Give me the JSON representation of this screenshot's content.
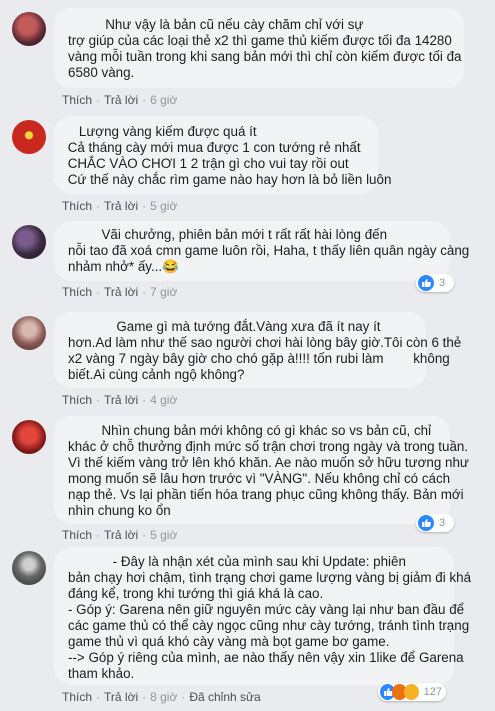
{
  "comments": [
    {
      "lines": [
        "          Như vậy là bản cũ nếu cày chăm chỉ với sự",
        "trợ giúp của các loại thẻ x2 thì game thủ kiếm được tối đa 14280",
        "vàng mỗi tuần trong khi sang bản mới thì chỉ còn kiếm được tối đa",
        "6580 vàng."
      ],
      "actions": [
        "Thích",
        "Trả lời"
      ],
      "time": "6 giờ"
    },
    {
      "lines": [
        "    Lượng vàng kiếm được quá ít",
        " Cả tháng cày mới mua được 1 con tướng rẻ nhất",
        " CHẮC VÀO CHƠI 1 2 trận gì cho vui tay rồi out",
        " Cứ thế này chắc rìm game nào hay hơn là bỏ liền luôn"
      ],
      "actions": [
        "Thích",
        "Trả lời"
      ],
      "time": "5 giờ"
    },
    {
      "lines": [
        "         Vãi chưởng, phiên bản mới t rất rất hài lòng đến",
        "nỗi tao đã xoá cmn game luôn rồi, Haha, t thấy liên quân ngày càng",
        "nhảm nhở* ấy...😂"
      ],
      "actions": [
        "Thích",
        "Trả lời"
      ],
      "time": "7 giờ",
      "reactions": {
        "count": "3"
      }
    },
    {
      "lines": [
        "             Game gì mà tướng đắt.Vàng xưa đã ít nay ít",
        "hơn.Ad làm như thế sao người chơi hài lòng bây giờ.Tôi còn 6 thẻ",
        "x2 vàng 7 ngày bây giờ cho chó gặp à!!!! tốn rubi làm        không",
        "biết.Ai cùng cảnh ngộ không?"
      ],
      "actions": [
        "Thích",
        "Trả lời"
      ],
      "time": "4 giờ"
    },
    {
      "lines": [
        "         Nhìn chung bản mới không có gì khác so vs bản cũ, chỉ",
        "khác ở chỗ thưởng định mức số trận chơi trong ngày và trong tuần.",
        "Vì thế kiếm vàng trở lên khó khăn. Ae nào muốn sở hữu tương như",
        "mong muốn sẽ lâu hơn trước vì \"VÀNG\". Nếu không chỉ có cách",
        "nạp thẻ. Vs lại phần tiến hóa trang phục cũng không thấy. Bản mới",
        "nhìn chung ko ổn"
      ],
      "actions": [
        "Thích",
        "Trả lời"
      ],
      "time": "5 giờ",
      "reactions": {
        "count": "3"
      }
    },
    {
      "lines": [
        "            - Đây là nhận xét của mình sau khi Update: phiên",
        "bản chạy hơi chậm, tình trạng chơi game lượng vàng bị giảm đi khá",
        "đáng kể, trong khi tướng thì giá khá là cao.",
        "- Góp ý: Garena nên giữ nguyên mức cày vàng lại như ban đầu để",
        "các game thủ có thể cày ngọc cũng như cày tướng, tránh tình trạng",
        "game thủ vì quá khó cày vàng mà bọt game bơ game.",
        "--> Góp ý riêng của mình, ae nào thấy nên vậy xin 1like để Garena",
        "tham khảo."
      ],
      "actions": [
        "Thích",
        "Trả lời"
      ],
      "time": "8 giờ",
      "edited": "Đã chỉnh sửa",
      "reactions": {
        "count": "127"
      }
    }
  ],
  "colors": {
    "background": "#e9ebee",
    "bubble": "#f2f3f5",
    "meta_text": "#90949c",
    "like_blue": "#2d88ff"
  }
}
